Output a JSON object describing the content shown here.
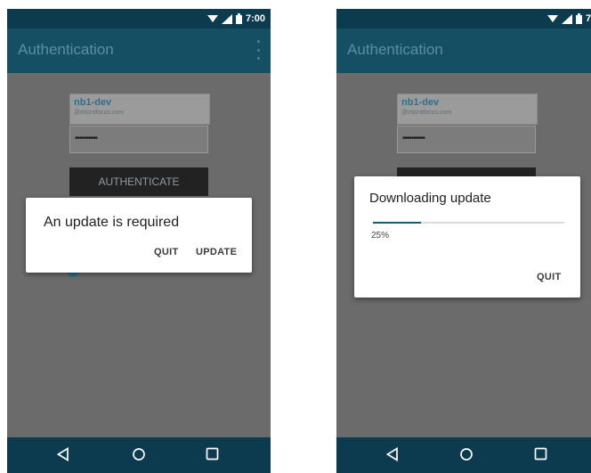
{
  "status_bar": {
    "time": "7:00"
  },
  "left_screen": {
    "app_title": "Authentication",
    "account_name": "nb1-dev",
    "account_email": "@microfocus.com",
    "password_mask": "••••••••••",
    "authenticate_label": "AUTHENTICATE",
    "dialog": {
      "title": "An update is required",
      "quit_label": "QUIT",
      "update_label": "UPDATE"
    }
  },
  "right_screen": {
    "app_title": "Authentication",
    "account_name": "nb1-dev",
    "account_email": "@microfocus.com",
    "password_mask": "••••••••••",
    "dialog": {
      "title": "Downloading update",
      "progress_percent_label": "25%",
      "progress_fraction": 0.25,
      "quit_label": "QUIT"
    }
  },
  "navigation": {
    "icons": [
      "back-icon",
      "home-icon",
      "recents-icon"
    ]
  },
  "colors": {
    "status_bar": "#0c3a4f",
    "app_bar": "#154f63",
    "scrim_background": "#6b6b6b",
    "progress_fill": "#1c5a6e"
  }
}
